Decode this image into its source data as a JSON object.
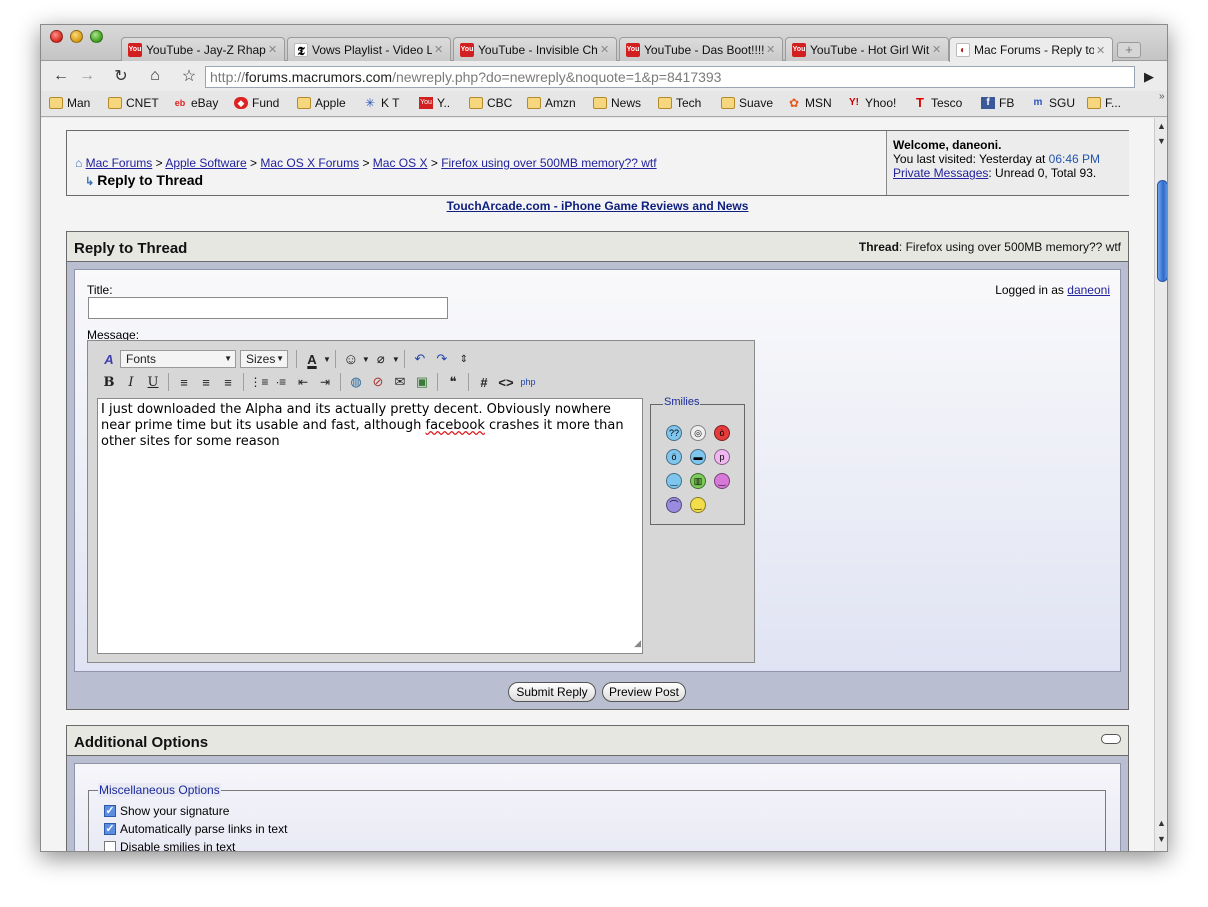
{
  "browser": {
    "tabs": [
      {
        "title": "YouTube - Jay-Z Rhaps",
        "icon": "youtube-favicon"
      },
      {
        "title": "Vows Playlist - Video L",
        "icon": "nytimes-favicon"
      },
      {
        "title": "YouTube - Invisible Ch",
        "icon": "youtube-favicon"
      },
      {
        "title": "YouTube - Das Boot!!!!",
        "icon": "youtube-favicon"
      },
      {
        "title": "YouTube - Hot Girl Wit",
        "icon": "youtube-favicon"
      },
      {
        "title": "Mac Forums - Reply to",
        "icon": "macrumors-favicon",
        "active": true
      }
    ],
    "url_scheme": "http://",
    "url_host": "forums.macrumors.com",
    "url_path": "/newreply.php?do=newreply&noquote=1&p=8417393",
    "bookmarks": [
      {
        "label": "Man",
        "icon": "folder-icon"
      },
      {
        "label": "CNET",
        "icon": "folder-icon"
      },
      {
        "label": "eBay",
        "icon": "ebay-icon"
      },
      {
        "label": "Fund",
        "icon": "fund-icon"
      },
      {
        "label": "Apple",
        "icon": "folder-icon"
      },
      {
        "label": "K T",
        "icon": "kt-icon"
      },
      {
        "label": "Y..",
        "icon": "youtube-icon"
      },
      {
        "label": "CBC",
        "icon": "folder-icon"
      },
      {
        "label": "Amzn",
        "icon": "folder-icon"
      },
      {
        "label": "News",
        "icon": "folder-icon"
      },
      {
        "label": "Tech",
        "icon": "folder-icon"
      },
      {
        "label": "Suave",
        "icon": "folder-icon"
      },
      {
        "label": "MSN",
        "icon": "msn-icon"
      },
      {
        "label": "Yhoo!",
        "icon": "yahoo-icon"
      },
      {
        "label": "Tesco",
        "icon": "tesco-icon"
      },
      {
        "label": "FB",
        "icon": "facebook-icon"
      },
      {
        "label": "SGU",
        "icon": "sgu-icon"
      },
      {
        "label": "F...",
        "icon": "folder-icon"
      }
    ]
  },
  "page": {
    "breadcrumb": [
      "Mac Forums",
      "Apple Software",
      "Mac OS X Forums",
      "Mac OS X",
      "Firefox using over 500MB memory?? wtf"
    ],
    "breadcrumb_sep": ">",
    "crumb_title": "Reply to Thread",
    "welcome": {
      "greeting": "Welcome, daneoni.",
      "last_visited_label": "You last visited: Yesterday at",
      "last_visited_time": "06:46 PM",
      "pm_link": "Private Messages",
      "pm_stats": ": Unread 0, Total 93."
    },
    "promo_link": "TouchArcade.com - iPhone Game Reviews and News",
    "reply": {
      "heading": "Reply to Thread",
      "thread_label": "Thread",
      "thread_title": ": Firefox using over 500MB memory?? wtf",
      "title_label": "Title:",
      "message_label": "Message:",
      "logged_in_label": "Logged in as",
      "username": "daneoni",
      "fonts_label": "Fonts",
      "sizes_label": "Sizes",
      "message_before": "I just downloaded the Alpha and its actually pretty decent. Obviously nowhere near prime time but its usable and fast, although ",
      "message_misspelled": "facebook",
      "message_after": " crashes it more than other sites for some reason",
      "smilies_label": "Smilies",
      "submit": "Submit Reply",
      "preview": "Preview Post"
    },
    "options": {
      "heading": "Additional Options",
      "misc_legend": "Miscellaneous Options",
      "items": [
        {
          "label": "Show your signature",
          "checked": true
        },
        {
          "label": "Automatically parse links in text",
          "checked": true
        },
        {
          "label": "Disable smilies in text",
          "checked": false
        }
      ]
    }
  },
  "colors": {
    "link": "#22229c",
    "panel_bg": "#b9bfd0",
    "header_bg": "#e7e7e2",
    "scroll_thumb": "#2e6ad0"
  }
}
